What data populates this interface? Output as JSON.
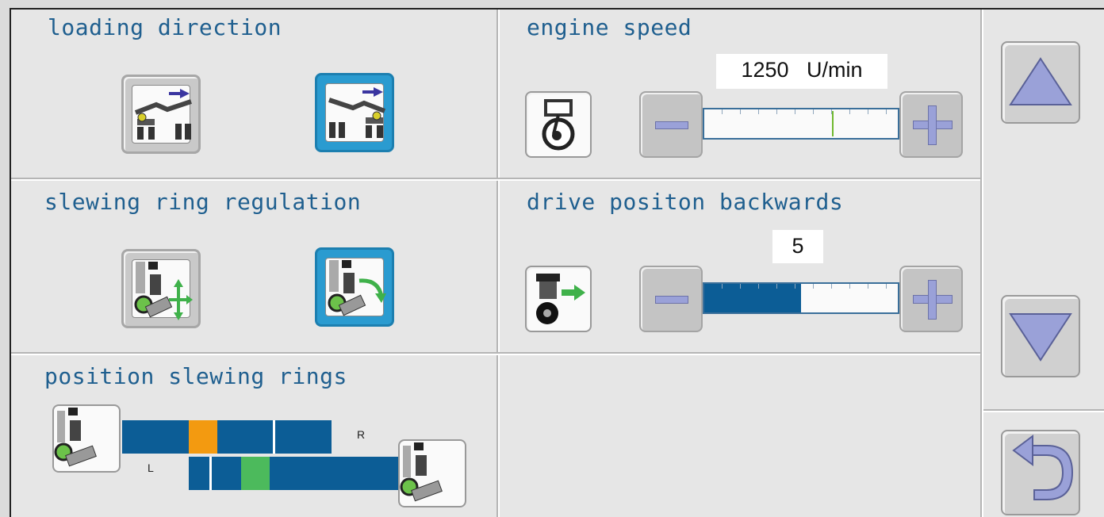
{
  "panels": {
    "loading_direction": {
      "title": "loading direction"
    },
    "engine_speed": {
      "title": "engine speed",
      "value": "1250",
      "unit": "U/min",
      "level": 0.66
    },
    "slewing_ring_regulation": {
      "title": "slewing ring regulation"
    },
    "drive_position_backwards": {
      "title": "drive positon backwards",
      "value": "5",
      "level": 0.5
    },
    "position_slewing_rings": {
      "title": "position slewing rings",
      "label_r": "R",
      "label_l": "L"
    }
  },
  "colors": {
    "accent": "#1f5f8f",
    "active_button": "#2a9bd0",
    "bar_blue": "#0c5d96",
    "orange": "#f39a10",
    "green": "#4cba5c",
    "arrow": "#9aa1d8"
  },
  "icons": {
    "up": "triangle-up-icon",
    "down": "triangle-down-icon",
    "back": "return-arrow-icon",
    "engine": "engine-piston-icon",
    "drive": "drive-unit-icon"
  }
}
